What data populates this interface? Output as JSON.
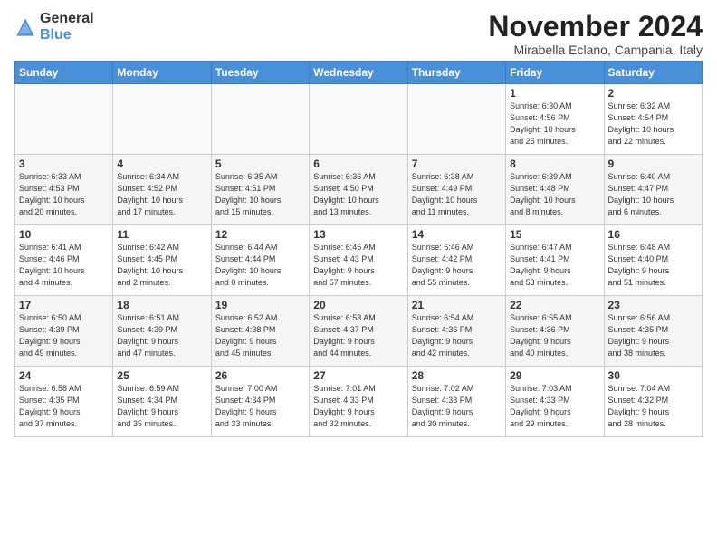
{
  "logo": {
    "general": "General",
    "blue": "Blue"
  },
  "title": "November 2024",
  "location": "Mirabella Eclano, Campania, Italy",
  "days_of_week": [
    "Sunday",
    "Monday",
    "Tuesday",
    "Wednesday",
    "Thursday",
    "Friday",
    "Saturday"
  ],
  "weeks": [
    [
      {
        "day": "",
        "info": ""
      },
      {
        "day": "",
        "info": ""
      },
      {
        "day": "",
        "info": ""
      },
      {
        "day": "",
        "info": ""
      },
      {
        "day": "",
        "info": ""
      },
      {
        "day": "1",
        "info": "Sunrise: 6:30 AM\nSunset: 4:56 PM\nDaylight: 10 hours\nand 25 minutes."
      },
      {
        "day": "2",
        "info": "Sunrise: 6:32 AM\nSunset: 4:54 PM\nDaylight: 10 hours\nand 22 minutes."
      }
    ],
    [
      {
        "day": "3",
        "info": "Sunrise: 6:33 AM\nSunset: 4:53 PM\nDaylight: 10 hours\nand 20 minutes."
      },
      {
        "day": "4",
        "info": "Sunrise: 6:34 AM\nSunset: 4:52 PM\nDaylight: 10 hours\nand 17 minutes."
      },
      {
        "day": "5",
        "info": "Sunrise: 6:35 AM\nSunset: 4:51 PM\nDaylight: 10 hours\nand 15 minutes."
      },
      {
        "day": "6",
        "info": "Sunrise: 6:36 AM\nSunset: 4:50 PM\nDaylight: 10 hours\nand 13 minutes."
      },
      {
        "day": "7",
        "info": "Sunrise: 6:38 AM\nSunset: 4:49 PM\nDaylight: 10 hours\nand 11 minutes."
      },
      {
        "day": "8",
        "info": "Sunrise: 6:39 AM\nSunset: 4:48 PM\nDaylight: 10 hours\nand 8 minutes."
      },
      {
        "day": "9",
        "info": "Sunrise: 6:40 AM\nSunset: 4:47 PM\nDaylight: 10 hours\nand 6 minutes."
      }
    ],
    [
      {
        "day": "10",
        "info": "Sunrise: 6:41 AM\nSunset: 4:46 PM\nDaylight: 10 hours\nand 4 minutes."
      },
      {
        "day": "11",
        "info": "Sunrise: 6:42 AM\nSunset: 4:45 PM\nDaylight: 10 hours\nand 2 minutes."
      },
      {
        "day": "12",
        "info": "Sunrise: 6:44 AM\nSunset: 4:44 PM\nDaylight: 10 hours\nand 0 minutes."
      },
      {
        "day": "13",
        "info": "Sunrise: 6:45 AM\nSunset: 4:43 PM\nDaylight: 9 hours\nand 57 minutes."
      },
      {
        "day": "14",
        "info": "Sunrise: 6:46 AM\nSunset: 4:42 PM\nDaylight: 9 hours\nand 55 minutes."
      },
      {
        "day": "15",
        "info": "Sunrise: 6:47 AM\nSunset: 4:41 PM\nDaylight: 9 hours\nand 53 minutes."
      },
      {
        "day": "16",
        "info": "Sunrise: 6:48 AM\nSunset: 4:40 PM\nDaylight: 9 hours\nand 51 minutes."
      }
    ],
    [
      {
        "day": "17",
        "info": "Sunrise: 6:50 AM\nSunset: 4:39 PM\nDaylight: 9 hours\nand 49 minutes."
      },
      {
        "day": "18",
        "info": "Sunrise: 6:51 AM\nSunset: 4:39 PM\nDaylight: 9 hours\nand 47 minutes."
      },
      {
        "day": "19",
        "info": "Sunrise: 6:52 AM\nSunset: 4:38 PM\nDaylight: 9 hours\nand 45 minutes."
      },
      {
        "day": "20",
        "info": "Sunrise: 6:53 AM\nSunset: 4:37 PM\nDaylight: 9 hours\nand 44 minutes."
      },
      {
        "day": "21",
        "info": "Sunrise: 6:54 AM\nSunset: 4:36 PM\nDaylight: 9 hours\nand 42 minutes."
      },
      {
        "day": "22",
        "info": "Sunrise: 6:55 AM\nSunset: 4:36 PM\nDaylight: 9 hours\nand 40 minutes."
      },
      {
        "day": "23",
        "info": "Sunrise: 6:56 AM\nSunset: 4:35 PM\nDaylight: 9 hours\nand 38 minutes."
      }
    ],
    [
      {
        "day": "24",
        "info": "Sunrise: 6:58 AM\nSunset: 4:35 PM\nDaylight: 9 hours\nand 37 minutes."
      },
      {
        "day": "25",
        "info": "Sunrise: 6:59 AM\nSunset: 4:34 PM\nDaylight: 9 hours\nand 35 minutes."
      },
      {
        "day": "26",
        "info": "Sunrise: 7:00 AM\nSunset: 4:34 PM\nDaylight: 9 hours\nand 33 minutes."
      },
      {
        "day": "27",
        "info": "Sunrise: 7:01 AM\nSunset: 4:33 PM\nDaylight: 9 hours\nand 32 minutes."
      },
      {
        "day": "28",
        "info": "Sunrise: 7:02 AM\nSunset: 4:33 PM\nDaylight: 9 hours\nand 30 minutes."
      },
      {
        "day": "29",
        "info": "Sunrise: 7:03 AM\nSunset: 4:33 PM\nDaylight: 9 hours\nand 29 minutes."
      },
      {
        "day": "30",
        "info": "Sunrise: 7:04 AM\nSunset: 4:32 PM\nDaylight: 9 hours\nand 28 minutes."
      }
    ]
  ]
}
